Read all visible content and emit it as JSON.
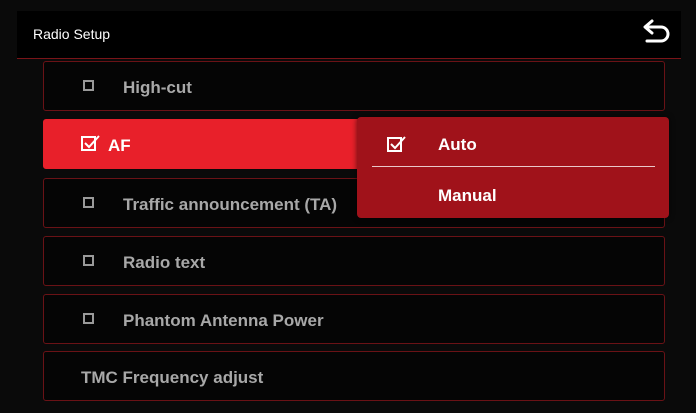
{
  "header": {
    "title": "Radio Setup",
    "back_icon": "back-arrow-icon"
  },
  "rows": [
    {
      "label": "High-cut",
      "checked": false,
      "has_checkbox": true,
      "selected": false
    },
    {
      "label": "AF",
      "checked": true,
      "has_checkbox": true,
      "selected": true
    },
    {
      "label": "Traffic announcement (TA)",
      "checked": false,
      "has_checkbox": true,
      "selected": false
    },
    {
      "label": "Radio text",
      "checked": false,
      "has_checkbox": true,
      "selected": false
    },
    {
      "label": "Phantom Antenna Power",
      "checked": false,
      "has_checkbox": true,
      "selected": false
    },
    {
      "label": "TMC Frequency adjust",
      "checked": false,
      "has_checkbox": false,
      "selected": false
    }
  ],
  "popup": {
    "options": [
      {
        "label": "Auto",
        "checked": true
      },
      {
        "label": "Manual",
        "checked": false
      }
    ]
  },
  "colors": {
    "accent": "#e8202a",
    "popup": "#a0121a",
    "border": "#6a1216",
    "text_dim": "#a8a8a8"
  }
}
